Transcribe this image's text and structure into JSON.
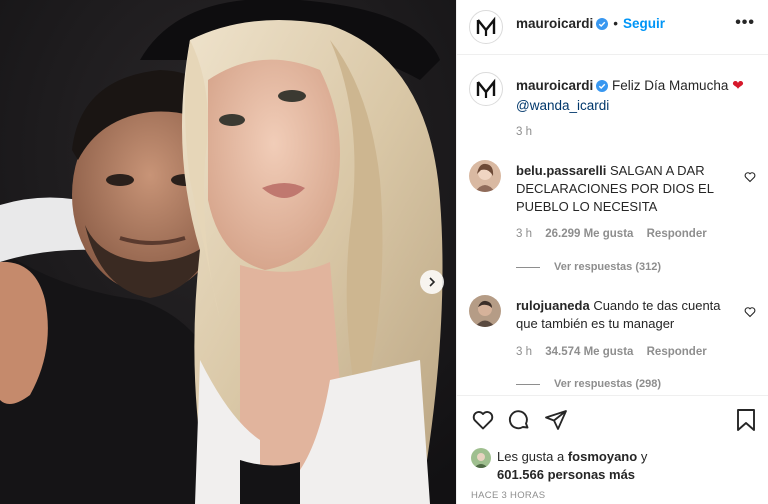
{
  "post": {
    "author": "mauroicardi",
    "follow_label": "Seguir",
    "separator": "•",
    "more_label": "•••"
  },
  "caption": {
    "author": "mauroicardi",
    "text": "Feliz Día Mamucha",
    "heart": "❤",
    "mention": "@wanda_icardi",
    "time": "3 h"
  },
  "comments": [
    {
      "user": "belu.passarelli",
      "text": "SALGAN A DAR DECLARACIONES POR DIOS EL PUEBLO LO NECESITA",
      "time": "3 h",
      "likes": "26.299 Me gusta",
      "reply_label": "Responder",
      "view_replies": "Ver respuestas (312)"
    },
    {
      "user": "rulojuaneda",
      "text": "Cuando te das cuenta que también es tu manager",
      "time": "3 h",
      "likes": "34.574 Me gusta",
      "reply_label": "Responder",
      "view_replies": "Ver respuestas (298)"
    }
  ],
  "likes": {
    "prefix": "Les gusta a",
    "user": "fosmoyano",
    "conj": "y",
    "count": "601.566 personas más"
  },
  "posted_time": "HACE 3 HORAS",
  "icons": {
    "verified": "verified-badge-icon",
    "like": "heart-icon",
    "comment": "comment-bubble-icon",
    "share": "paper-plane-icon",
    "save": "bookmark-icon",
    "next": "chevron-right-icon"
  },
  "colors": {
    "accent": "#0095f6",
    "verified": "#3897f0",
    "heart": "#d6182b",
    "muted": "#8e8e8e",
    "text": "#262626"
  }
}
